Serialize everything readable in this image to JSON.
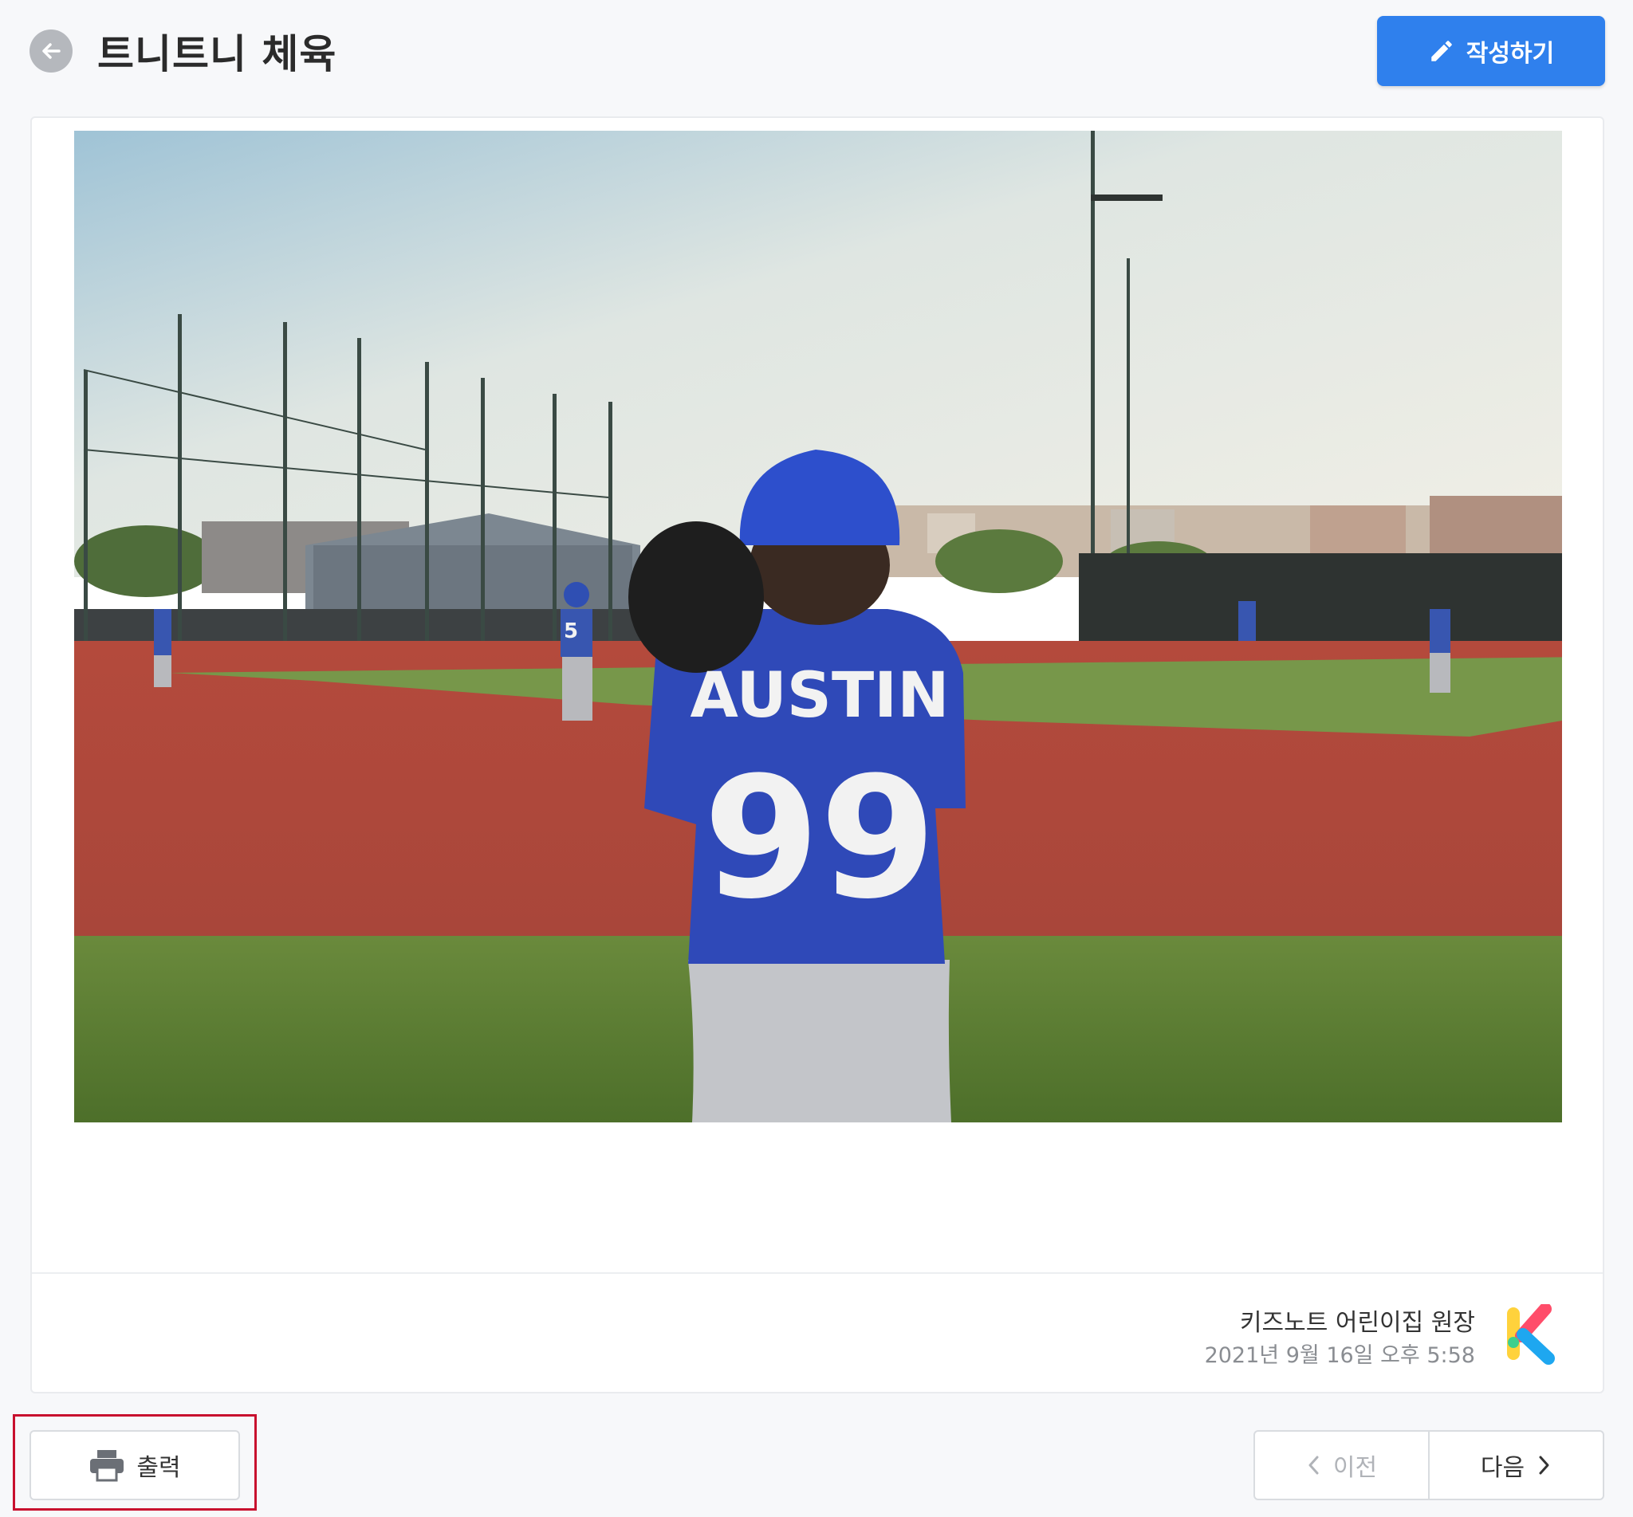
{
  "header": {
    "back_icon": "arrow-left-icon",
    "title": "트니트니 체육",
    "write_button": {
      "icon": "pencil-icon",
      "label": "작성하기"
    },
    "accent_color": "#2f80ed"
  },
  "post": {
    "photo": {
      "jersey_name": "AUSTIN",
      "jersey_number": "99",
      "small_player_number": "5"
    },
    "author": "키즈노트 어린이집 원장",
    "date": "2021년 9월 16일 오후 5:58",
    "logo_icon": "kidsnote-k-logo"
  },
  "footer": {
    "print_button": {
      "icon": "printer-icon",
      "label": "출력"
    },
    "highlight_color": "#c8102e",
    "prev_button": {
      "icon": "chevron-left-icon",
      "label": "이전"
    },
    "next_button": {
      "icon": "chevron-right-icon",
      "label": "다음"
    }
  }
}
